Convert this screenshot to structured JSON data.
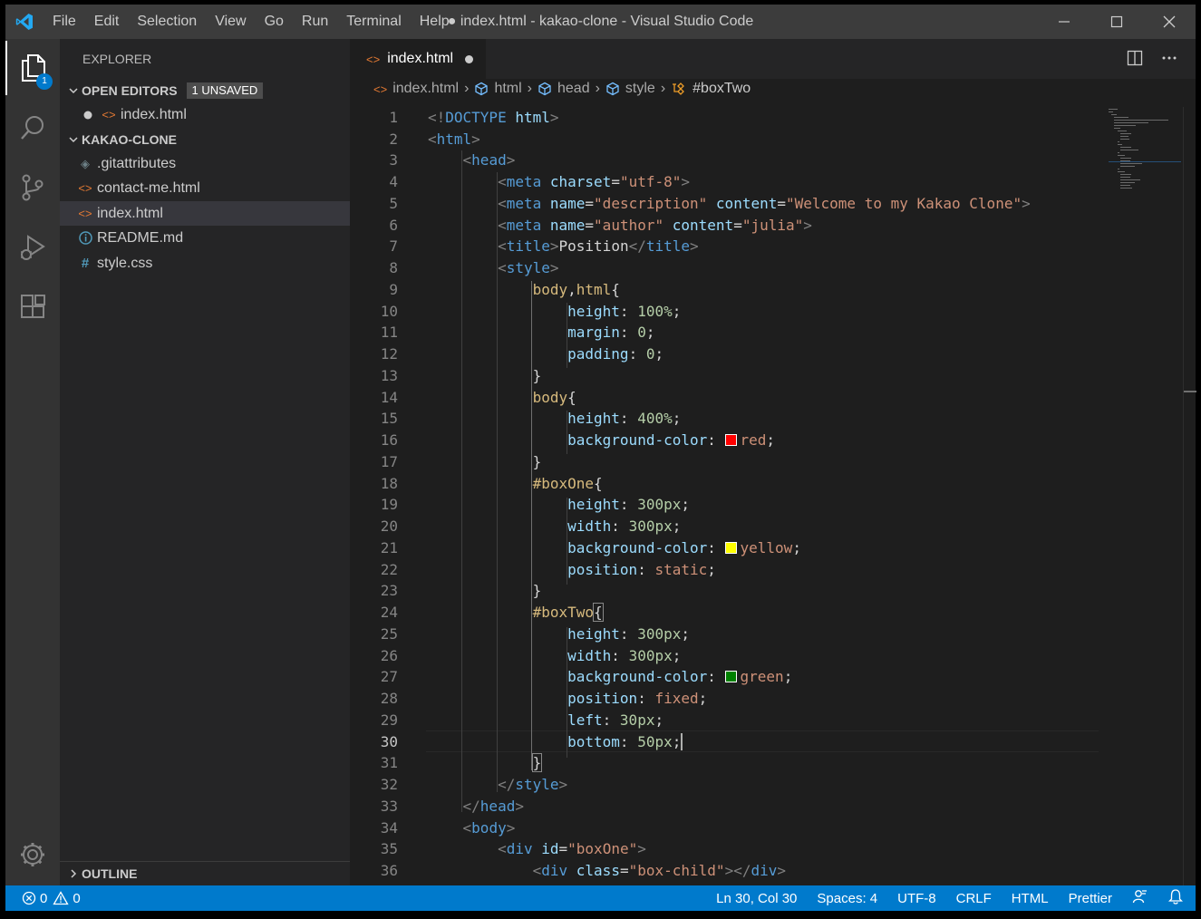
{
  "titlebar": {
    "menu": [
      "File",
      "Edit",
      "Selection",
      "View",
      "Go",
      "Run",
      "Terminal",
      "Help"
    ],
    "title": "● index.html - kakao-clone - Visual Studio Code"
  },
  "activity": {
    "explorer_badge": "1"
  },
  "sidebar": {
    "title": "EXPLORER",
    "open_editors": {
      "label": "OPEN EDITORS",
      "badge": "1 UNSAVED",
      "file": "index.html"
    },
    "project": {
      "label": "KAKAO-CLONE",
      "files": [
        {
          "name": ".gitattributes",
          "icon": "gear-file-icon",
          "color": "#6d8086"
        },
        {
          "name": "contact-me.html",
          "icon": "html-file-icon",
          "color": "#e37933"
        },
        {
          "name": "index.html",
          "icon": "html-file-icon",
          "color": "#e37933"
        },
        {
          "name": "README.md",
          "icon": "info-file-icon",
          "color": "#519aba"
        },
        {
          "name": "style.css",
          "icon": "css-file-icon",
          "color": "#519aba"
        }
      ]
    },
    "outline": "OUTLINE"
  },
  "editor": {
    "tab": "index.html",
    "breadcrumbs": [
      "index.html",
      "html",
      "head",
      "style",
      "#boxTwo"
    ],
    "cursor_line": 30
  },
  "statusbar": {
    "errors": "0",
    "warnings": "0",
    "position": "Ln 30, Col 30",
    "spaces": "Spaces: 4",
    "encoding": "UTF-8",
    "eol": "CRLF",
    "language": "HTML",
    "formatter": "Prettier"
  },
  "colors": {
    "accent": "#007acc",
    "swatch_red": "#ff0000",
    "swatch_yellow": "#ffff00",
    "swatch_green": "#008000"
  }
}
